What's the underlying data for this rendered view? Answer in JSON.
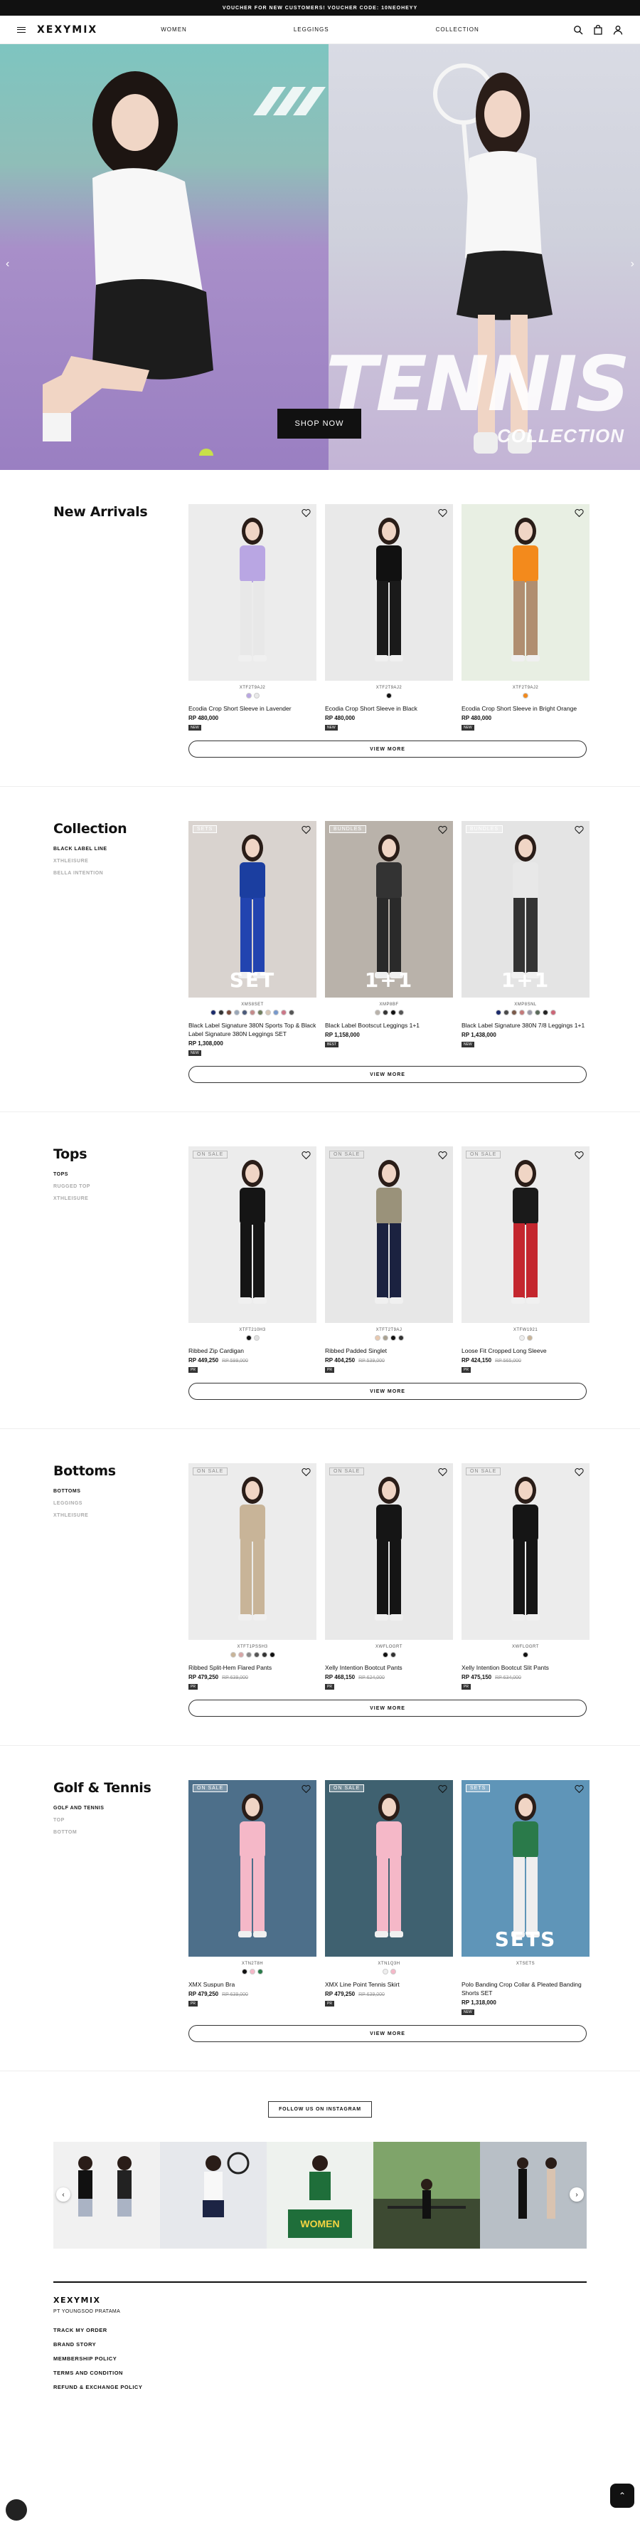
{
  "announcement": "VOUCHER FOR NEW CUSTOMERS! VOUCHER CODE: 10NEOHEYY",
  "header": {
    "logo": "XEXYMIX",
    "nav": [
      "WOMEN",
      "LEGGINGS",
      "COLLECTION"
    ],
    "icons": [
      "menu-icon",
      "search-icon",
      "bag-icon",
      "user-icon"
    ]
  },
  "hero": {
    "headline": "TENNIS",
    "subline": "COLLECTION",
    "cta": "SHOP NOW"
  },
  "new_arrivals": {
    "title": "New Arrivals",
    "view_more": "VIEW MORE",
    "products": [
      {
        "code": "XTF2T9AJ2",
        "name": "Ecodia Crop Short Sleeve in Lavender",
        "price": "RP 480,000",
        "badge": "NEW",
        "swatches": [
          "#b9a6e3",
          "#e9e9e9"
        ]
      },
      {
        "code": "XTF2T9AJ2",
        "name": "Ecodia Crop Short Sleeve in Black",
        "price": "RP 480,000",
        "badge": "NEW",
        "swatches": [
          "#111111"
        ]
      },
      {
        "code": "XTF2T9AJ2",
        "name": "Ecodia Crop Short Sleeve in Bright Orange",
        "price": "RP 480,000",
        "badge": "NEW",
        "swatches": [
          "#f38a1c"
        ]
      }
    ]
  },
  "collection": {
    "title": "Collection",
    "subs": [
      "BLACK LABEL LINE",
      "XTHLEISURE",
      "BELLA INTENTION"
    ],
    "view_more": "VIEW MORE",
    "products": [
      {
        "tag": "SETS",
        "big": "SET",
        "code": "XMS8SET",
        "name": "Black Label Signature 380N Sports Top & Black Label Signature 380N Leggings SET",
        "price": "RP 1,308,000",
        "badge": "NEW",
        "swatches": [
          "#1b2b6b",
          "#333333",
          "#7a4b3b",
          "#9aa7b8",
          "#4a5a7a",
          "#c48b8b",
          "#6f7f5f",
          "#d8c8b8",
          "#7799cc",
          "#cc7788",
          "#555555"
        ]
      },
      {
        "tag": "BUNDLES",
        "big": "1+1",
        "code": "XMP8BF",
        "name": "Black Label Bootscut Leggings 1+1",
        "price": "RP 1,158,000",
        "badge": "BEST",
        "swatches": [
          "#b9b2aa",
          "#333333",
          "#111111",
          "#555555"
        ]
      },
      {
        "tag": "BUNDLES",
        "big": "1+1",
        "code": "XMP8SNL",
        "name": "Black Label Signature 380N 7/8 Leggings 1+1",
        "price": "RP 1,438,000",
        "badge": "NEW",
        "swatches": [
          "#1b2b6b",
          "#4a4a4a",
          "#7a5a4a",
          "#c47a7a",
          "#9a9aa8",
          "#5a6a5a",
          "#222222",
          "#cc6677"
        ]
      }
    ]
  },
  "tops": {
    "title": "Tops",
    "subs": [
      "TOPS",
      "RUGGED TOP",
      "XTHLEISURE"
    ],
    "view_more": "VIEW MORE",
    "products": [
      {
        "tag": "ON SALE",
        "code": "XTFT210H3",
        "name": "Ribbed Zip Cardigan",
        "price": "RP 449,250",
        "old": "RP 599,000",
        "badge": "PR",
        "swatches": [
          "#111111",
          "#e0e0e0"
        ]
      },
      {
        "tag": "ON SALE",
        "code": "XTFT2T9AJ",
        "name": "Ribbed Padded Singlet",
        "price": "RP 404,250",
        "old": "RP 539,000",
        "badge": "PR",
        "swatches": [
          "#e8c9b0",
          "#a8a090",
          "#111111",
          "#333333"
        ]
      },
      {
        "tag": "ON SALE",
        "code": "XTFW1921",
        "name": "Loose Fit Cropped Long Sleeve",
        "price": "RP 424,150",
        "old": "RP 565,000",
        "badge": "PR",
        "swatches": [
          "#eeeeee",
          "#c8b498"
        ]
      }
    ]
  },
  "bottoms": {
    "title": "Bottoms",
    "subs": [
      "BOTTOMS",
      "LEGGINGS",
      "XTHLEISURE"
    ],
    "view_more": "VIEW MORE",
    "products": [
      {
        "tag": "ON SALE",
        "code": "XTFT1PSSH3",
        "name": "Ribbed Split-Hem Flared Pants",
        "price": "RP 479,250",
        "old": "RP 639,000",
        "badge": "PR",
        "swatches": [
          "#c8b498",
          "#d7a6a6",
          "#8a8a8a",
          "#555555",
          "#333333",
          "#111111"
        ]
      },
      {
        "tag": "ON SALE",
        "code": "XWFLOGRT",
        "name": "Xelly Intention Bootcut Pants",
        "price": "RP 468,150",
        "old": "RP 624,000",
        "badge": "PR",
        "swatches": [
          "#111111",
          "#333333"
        ]
      },
      {
        "tag": "ON SALE",
        "code": "XWFLOGRT",
        "name": "Xelly Intention Bootcut Slit Pants",
        "price": "RP 475,150",
        "old": "RP 634,000",
        "badge": "PR",
        "swatches": [
          "#111111"
        ]
      }
    ]
  },
  "golf": {
    "title": "Golf & Tennis",
    "subs": [
      "GOLF AND TENNIS",
      "TOP",
      "BOTTOM"
    ],
    "view_more": "VIEW MORE",
    "products": [
      {
        "tag": "ON SALE",
        "code": "XTN2T8H",
        "name": "XMX Suspun Bra",
        "price": "RP 479,250",
        "old": "RP 639,000",
        "badge": "PR",
        "swatches": [
          "#111111",
          "#f5b8c8",
          "#2a7a4a"
        ]
      },
      {
        "tag": "ON SALE",
        "code": "XTN1Q3H",
        "name": "XMX Line Point Tennis Skirt",
        "price": "RP 479,250",
        "old": "RP 639,000",
        "badge": "PR",
        "swatches": [
          "#eeeeee",
          "#f5b8c8"
        ]
      },
      {
        "tag": "SETS",
        "big": "SETS",
        "code": "XTSETS",
        "name": "Polo Banding Crop Collar & Pleated Banding Shorts SET",
        "price": "RP 1,318,000",
        "badge": "NEW",
        "swatches": []
      }
    ]
  },
  "instagram": {
    "button": "FOLLOW US ON INSTAGRAM"
  },
  "footer": {
    "logo": "XEXYMIX",
    "company": "PT YOUNGSOO PRATAMA",
    "links": [
      "TRACK MY ORDER",
      "BRAND STORY",
      "MEMBERSHIP POLICY",
      "TERMS AND CONDITION",
      "REFUND & EXCHANGE POLICY"
    ]
  }
}
